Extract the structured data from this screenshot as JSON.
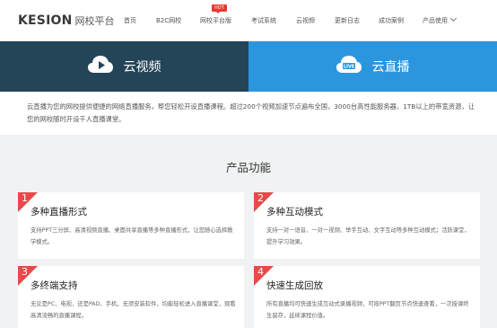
{
  "header": {
    "logo_en": "KESION",
    "logo_cn": "网校平台",
    "nav": [
      {
        "label": "首页"
      },
      {
        "label": "B2C网校"
      },
      {
        "label": "网校平台版"
      },
      {
        "label": "考试系统"
      },
      {
        "label": "云视频"
      },
      {
        "label": "更新日志"
      },
      {
        "label": "成功案例"
      },
      {
        "label": "产品使用"
      }
    ],
    "hot_badge": "HOT"
  },
  "banner": {
    "tabs": [
      {
        "label": "云视频",
        "icon": "play-cloud-icon",
        "color": "#244457"
      },
      {
        "label": "云直播",
        "icon": "live-cloud-icon",
        "color": "#2b96de",
        "icon_text": "LIVE"
      }
    ]
  },
  "intro": {
    "text": "云直播为您的网校提供便捷的网络直播服务，帮您轻松开设直播课程。超过200个视频加速节点遍布全国，3000台高性能服务器，1TB以上的带宽资源，让您的网校随时开设千人直播课堂。"
  },
  "features": {
    "title": "产品功能",
    "items": [
      {
        "num": "1",
        "title": "多种直播形式",
        "desc": "支持PPT三分屏、高清视频直播、桌面共享直播等多种直播形式，让您随心选择教学模式。"
      },
      {
        "num": "2",
        "title": "多种互动模式",
        "desc": "支持一对一语音、一对一视频、举手互动、文字互动等多种互动模式；活跃课堂，提升学习效果。"
      },
      {
        "num": "3",
        "title": "多终端支持",
        "desc": "无论是PC、电视、还是PAD、手机，无须安装软件，均能轻松进入直播课堂，观看高清流畅的直播课程。"
      },
      {
        "num": "4",
        "title": "快速生成回放",
        "desc": "所有直播均可快速生成互动式录播视频，可按PPT翻页节点快速查看，一次授课终生留存，延续课程价值。"
      }
    ],
    "accent": "#e84a4a"
  }
}
